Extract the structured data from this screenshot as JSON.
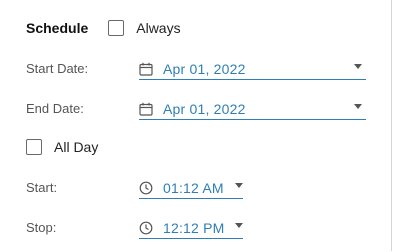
{
  "header": {
    "title": "Schedule",
    "always_label": "Always",
    "always_checked": false
  },
  "start_date": {
    "label": "Start Date:",
    "value": "Apr 01, 2022",
    "icon": "calendar-icon"
  },
  "end_date": {
    "label": "End Date:",
    "value": "Apr 01, 2022",
    "icon": "calendar-icon"
  },
  "all_day": {
    "label": "All Day",
    "checked": false
  },
  "start_time": {
    "label": "Start:",
    "value": "01:12 AM",
    "icon": "clock-icon"
  },
  "stop_time": {
    "label": "Stop:",
    "value": "12:12 PM",
    "icon": "clock-icon"
  },
  "colors": {
    "accent": "#2f7fb5",
    "label": "#555555",
    "text": "#1a1a1a"
  }
}
